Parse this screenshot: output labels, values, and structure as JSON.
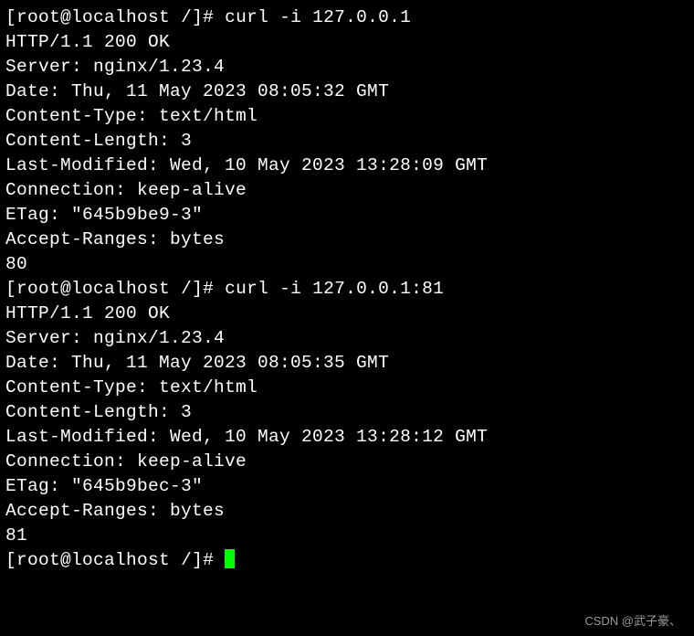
{
  "prompt": {
    "open": "[",
    "user": "root",
    "at": "@",
    "host": "localhost",
    "path": " /",
    "close": "]",
    "symbol": "#"
  },
  "block1": {
    "command": "curl -i 127.0.0.1",
    "lines": [
      "HTTP/1.1 200 OK",
      "Server: nginx/1.23.4",
      "Date: Thu, 11 May 2023 08:05:32 GMT",
      "Content-Type: text/html",
      "Content-Length: 3",
      "Last-Modified: Wed, 10 May 2023 13:28:09 GMT",
      "Connection: keep-alive",
      "ETag: \"645b9be9-3\"",
      "Accept-Ranges: bytes",
      "",
      "80"
    ]
  },
  "block2": {
    "command": "curl -i 127.0.0.1:81",
    "lines": [
      "HTTP/1.1 200 OK",
      "Server: nginx/1.23.4",
      "Date: Thu, 11 May 2023 08:05:35 GMT",
      "Content-Type: text/html",
      "Content-Length: 3",
      "Last-Modified: Wed, 10 May 2023 13:28:12 GMT",
      "Connection: keep-alive",
      "ETag: \"645b9bec-3\"",
      "Accept-Ranges: bytes",
      "",
      "81"
    ]
  },
  "watermark": "CSDN @武子豪、"
}
